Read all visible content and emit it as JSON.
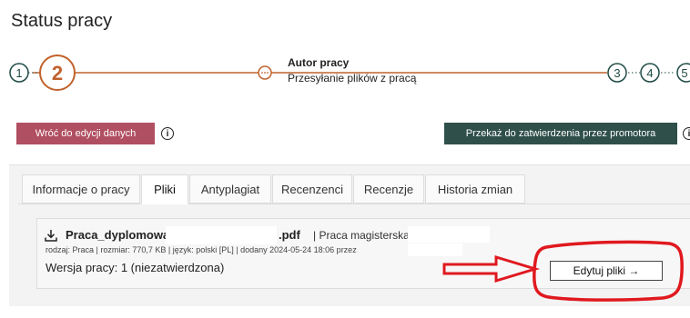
{
  "page": {
    "title": "Status pracy"
  },
  "stepper": {
    "steps": [
      "1",
      "2",
      "3",
      "4",
      "5"
    ],
    "current_title": "Autor pracy",
    "current_subtitle": "Przesyłanie plików z pracą",
    "colors": {
      "active": "#c0622b",
      "inactive": "#1f4b46"
    }
  },
  "actions": {
    "back_label": "Wróć do edycji danych",
    "send_label": "Przekaż do zatwierdzenia przez promotora",
    "info_glyph": "i",
    "colors": {
      "back": "#b14f62",
      "send": "#2f4f4a"
    }
  },
  "tabs": [
    {
      "label": "Informacje o pracy",
      "active": false
    },
    {
      "label": "Pliki",
      "active": true
    },
    {
      "label": "Antyplagiat",
      "active": false
    },
    {
      "label": "Recenzenci",
      "active": false
    },
    {
      "label": "Recenzje",
      "active": false
    },
    {
      "label": "Historia zmian",
      "active": false
    }
  ],
  "file": {
    "icon": "download-icon",
    "name": "Praca_dyplomowa",
    "ext": ".pdf",
    "kind": "| Praca magisterska -",
    "meta": "rodzaj: Praca | rozmiar: 770,7 KB | język: polski [PL] | dodany 2024-05-24 18:06 przez",
    "version": "Wersja pracy: 1 (niezatwierdzona)",
    "edit_label": "Edytuj pliki →"
  },
  "annotation": {
    "color": "#e0191f"
  }
}
